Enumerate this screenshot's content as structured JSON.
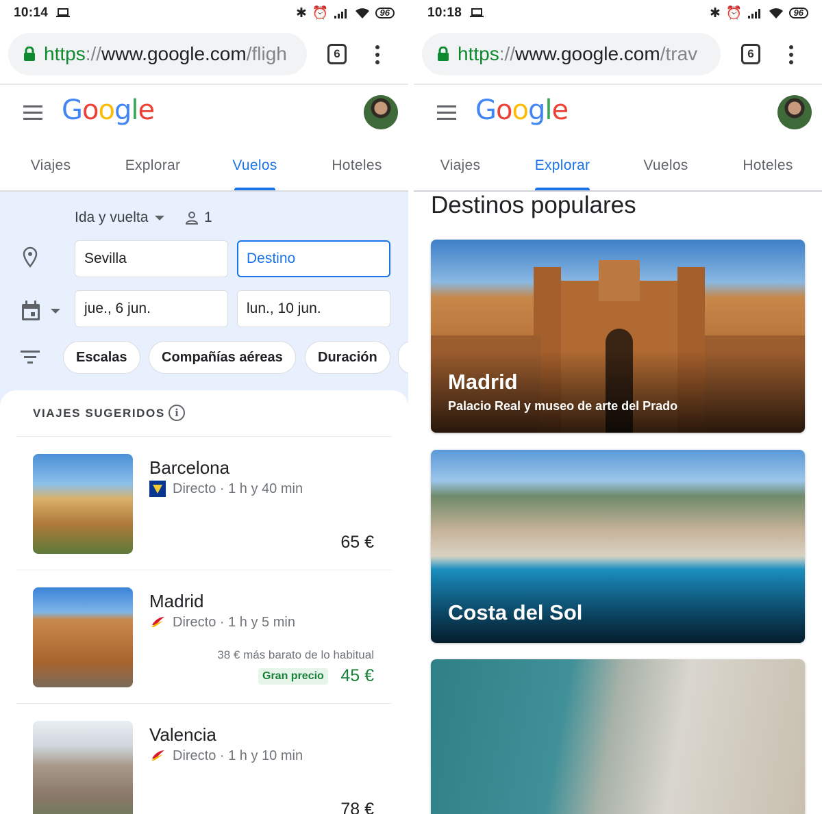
{
  "left": {
    "status": {
      "time": "10:14",
      "battery": "96"
    },
    "url": {
      "scheme": "https",
      "sep": "://",
      "host": "www.google.com",
      "path": "/fligh"
    },
    "tab_count": "6",
    "tabs": [
      "Viajes",
      "Explorar",
      "Vuelos",
      "Hoteles"
    ],
    "active_tab": "Vuelos",
    "search": {
      "trip_type": "Ida y vuelta",
      "passengers": "1",
      "origin": "Sevilla",
      "destination_placeholder": "Destino",
      "depart_date": "jue., 6 jun.",
      "return_date": "lun., 10 jun."
    },
    "filters": [
      "Escalas",
      "Compañías aéreas",
      "Duración"
    ],
    "suggestions_title": "VIAJES SUGERIDOS",
    "trips": [
      {
        "city": "Barcelona",
        "info": "Directo · 1 h y 40 min",
        "airline": "ryanair-icon",
        "price": "65 €"
      },
      {
        "city": "Madrid",
        "info": "Directo · 1 h y 5 min",
        "airline": "iberia-express-icon",
        "note": "38 € más barato de lo habitual",
        "badge": "Gran precio",
        "price": "45 €"
      },
      {
        "city": "Valencia",
        "info": "Directo · 1 h y 10 min",
        "airline": "iberia-icon",
        "price": "78 €"
      }
    ]
  },
  "right": {
    "status": {
      "time": "10:18",
      "battery": "96"
    },
    "url": {
      "scheme": "https",
      "sep": "://",
      "host": "www.google.com",
      "path": "/trav"
    },
    "tab_count": "6",
    "tabs": [
      "Viajes",
      "Explorar",
      "Vuelos",
      "Hoteles"
    ],
    "active_tab": "Explorar",
    "section_title": "Destinos populares",
    "destinations": [
      {
        "name": "Madrid",
        "subtitle": "Palacio Real y museo de arte del Prado"
      },
      {
        "name": "Costa del Sol",
        "subtitle": ""
      },
      {
        "name": "",
        "subtitle": ""
      }
    ]
  },
  "colors": {
    "accent": "#1a73e8",
    "green": "#188038",
    "panel": "#e8f0fe"
  }
}
